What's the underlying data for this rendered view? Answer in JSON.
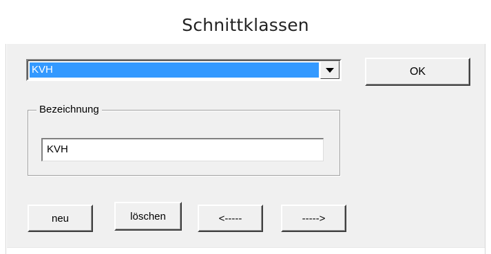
{
  "window": {
    "title": "Schnittklassen"
  },
  "dropdown": {
    "selected_value": "KVH",
    "arrow_icon": "chevron-down-icon"
  },
  "group": {
    "label": "Bezeichnung",
    "field_value": "KVH"
  },
  "buttons": {
    "ok": "OK",
    "neu": "neu",
    "loeschen": "löschen",
    "back": "<-----",
    "forward": "----->"
  },
  "colors": {
    "selection": "#3399ff",
    "face": "#f0f0f0"
  }
}
